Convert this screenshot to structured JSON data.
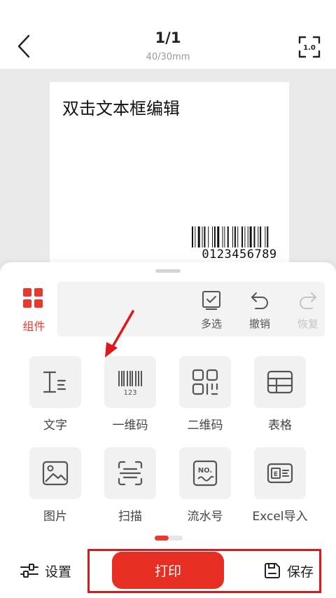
{
  "header": {
    "page_indicator": "1/1",
    "label_size": "40/30mm",
    "back_icon": "chevron-left-icon",
    "zoom_icon": "fit-screen-icon",
    "zoom_value": "1.0"
  },
  "canvas": {
    "text_box": "双击文本框编辑",
    "barcode_value": "0123456789"
  },
  "toolbar": {
    "components_tab": "组件",
    "multi_select": "多选",
    "undo": "撤销",
    "redo": "恢复"
  },
  "components": [
    {
      "label": "文字",
      "icon": "text-icon"
    },
    {
      "label": "一维码",
      "icon": "barcode-icon"
    },
    {
      "label": "二维码",
      "icon": "qrcode-icon"
    },
    {
      "label": "表格",
      "icon": "table-icon"
    },
    {
      "label": "图片",
      "icon": "image-icon"
    },
    {
      "label": "扫描",
      "icon": "scan-icon"
    },
    {
      "label": "流水号",
      "icon": "serial-number-icon"
    },
    {
      "label": "Excel导入",
      "icon": "excel-import-icon"
    }
  ],
  "pager": {
    "current_page": 1,
    "total_pages": 2
  },
  "bottom_bar": {
    "settings": "设置",
    "print": "打印",
    "save": "保存"
  },
  "colors": {
    "accent": "#e62f22",
    "annotation": "#e0161b",
    "canvas_bg": "#eaeaea"
  }
}
